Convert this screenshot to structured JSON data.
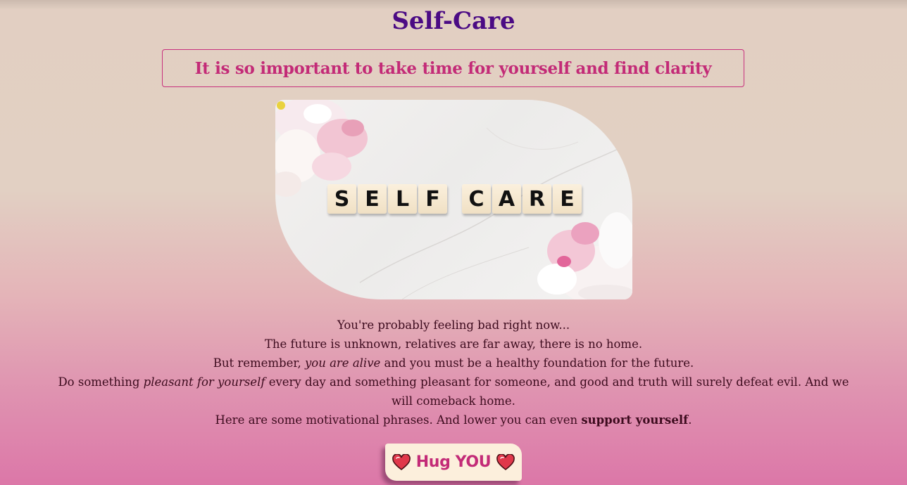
{
  "page": {
    "title": "Self-Care",
    "subtitle": "It is so important to take time for yourself and find clarity"
  },
  "hero": {
    "tiles_word1": [
      "S",
      "E",
      "L",
      "F"
    ],
    "tiles_word2": [
      "C",
      "A",
      "R",
      "E"
    ]
  },
  "body": {
    "line1": "You're probably feeling bad right now...",
    "line2": "The future is unknown, relatives are far away, there is no home.",
    "line3_a": "But remember, ",
    "line3_em": "you are alive",
    "line3_b": " and you must be a healthy foundation for the future.",
    "line4_a": "Do something ",
    "line4_em": "pleasant for yourself",
    "line4_b": " every day and something pleasant for someone, and good and truth will surely defeat evil. And we will comeback home.",
    "line5_a": "Here are some motivational phrases. And lower you can even ",
    "line5_strong": "support yourself",
    "line5_b": "."
  },
  "button": {
    "label": "Hug YOU",
    "icon_left": "heart-icon",
    "icon_right": "heart-icon"
  },
  "colors": {
    "title": "#4b0b84",
    "accent": "#c32b77",
    "body_text": "#3d0b1e",
    "button_bg": "#fcefdc"
  }
}
